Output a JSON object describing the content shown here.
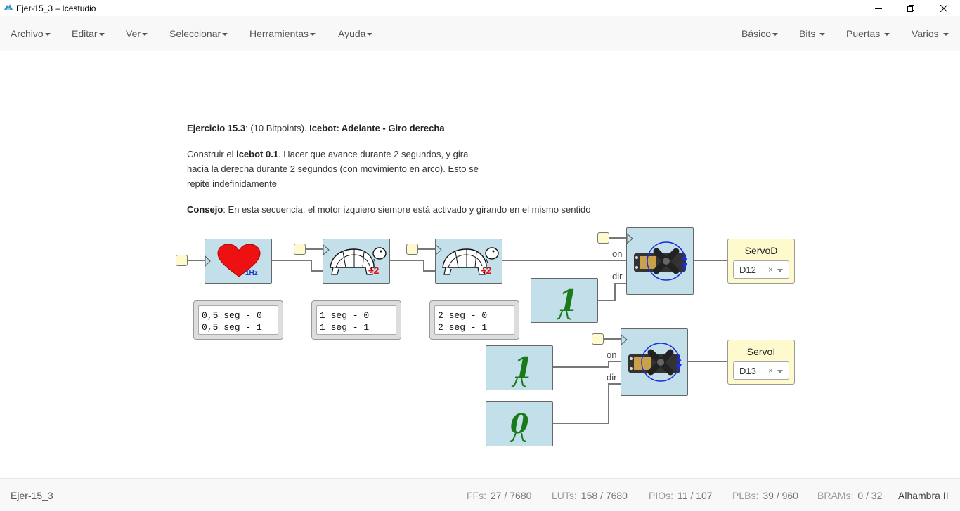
{
  "window": {
    "title": "Ejer-15_3 – Icestudio"
  },
  "menu": {
    "left": [
      "Archivo",
      "Editar",
      "Ver",
      "Seleccionar",
      "Herramientas",
      "Ayuda"
    ],
    "right": [
      "Básico",
      "Bits",
      "Puertas",
      "Varios"
    ]
  },
  "info": {
    "heading_bold": "Ejercicio 15.3",
    "heading_mid": ": (10 Bitpoints). ",
    "heading_title": "Icebot: Adelante - Giro derecha",
    "p1_a": "Construir el ",
    "p1_bold": "icebot 0.1",
    "p1_b": ". Hacer que avance durante 2 segundos, y gira",
    "p1_line2": "hacia la derecha durante 2 segundos (con movimiento en arco). Esto se",
    "p1_line3": "repite indefinidamente",
    "p2_bold": "Consejo",
    "p2_text": ": En esta secuencia, el motor izquiero siempre está activado y girando en el mismo sentido"
  },
  "blocks": {
    "heart_label": "1Hz",
    "div_label": "÷2",
    "const_one": "1",
    "const_zero": "0"
  },
  "memos": [
    {
      "line1": "0,5 seg - 0",
      "line2": "0,5 seg - 1"
    },
    {
      "line1": "1 seg - 0",
      "line2": "1 seg - 1"
    },
    {
      "line1": "2 seg - 0",
      "line2": "2 seg - 1"
    }
  ],
  "ports": {
    "on": "on",
    "dir": "dir"
  },
  "outputs": [
    {
      "name": "ServoD",
      "pin": "D12",
      "clear": "×"
    },
    {
      "name": "ServoI",
      "pin": "D13",
      "clear": "×"
    }
  ],
  "status": {
    "project": "Ejer-15_3",
    "ffs_label": "FFs:",
    "ffs": "27 / 7680",
    "luts_label": "LUTs:",
    "luts": "158 / 7680",
    "pios_label": "PIOs:",
    "pios": "11 / 107",
    "plbs_label": "PLBs:",
    "plbs": "39 / 960",
    "brams_label": "BRAMs:",
    "brams": "0 / 32",
    "board": "Alhambra II"
  }
}
